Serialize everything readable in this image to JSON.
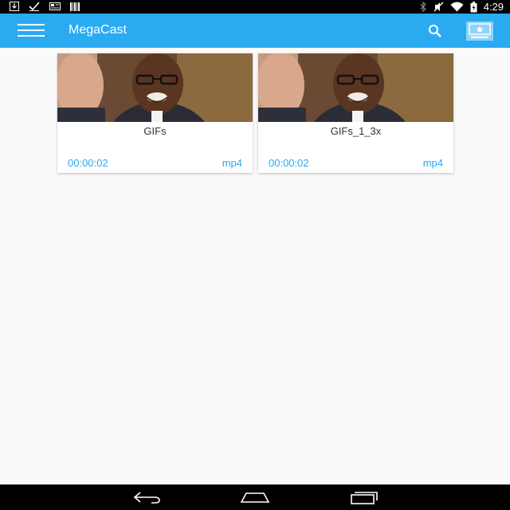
{
  "status_bar": {
    "time": "4:29",
    "left_icons": [
      "download-icon",
      "check-icon",
      "news-icon",
      "barcode-icon"
    ],
    "right_icons": [
      "bluetooth-icon",
      "mute-icon",
      "wifi-icon",
      "battery-icon"
    ]
  },
  "app_bar": {
    "title": "MegaCast",
    "background": "#2aaaf1",
    "menu_icon": "hamburger-menu-icon",
    "search_icon": "search-icon",
    "premium_icon": "premium-icon"
  },
  "videos": [
    {
      "title": "GIFs",
      "duration": "00:00:02",
      "format": "mp4"
    },
    {
      "title": "GIFs_1_3x",
      "duration": "00:00:02",
      "format": "mp4"
    }
  ],
  "nav_bar": {
    "buttons": [
      "back-icon",
      "home-icon",
      "recent-apps-icon"
    ]
  },
  "colors": {
    "accent": "#2aaaf1",
    "background": "#fafafa",
    "text": "#333333"
  }
}
